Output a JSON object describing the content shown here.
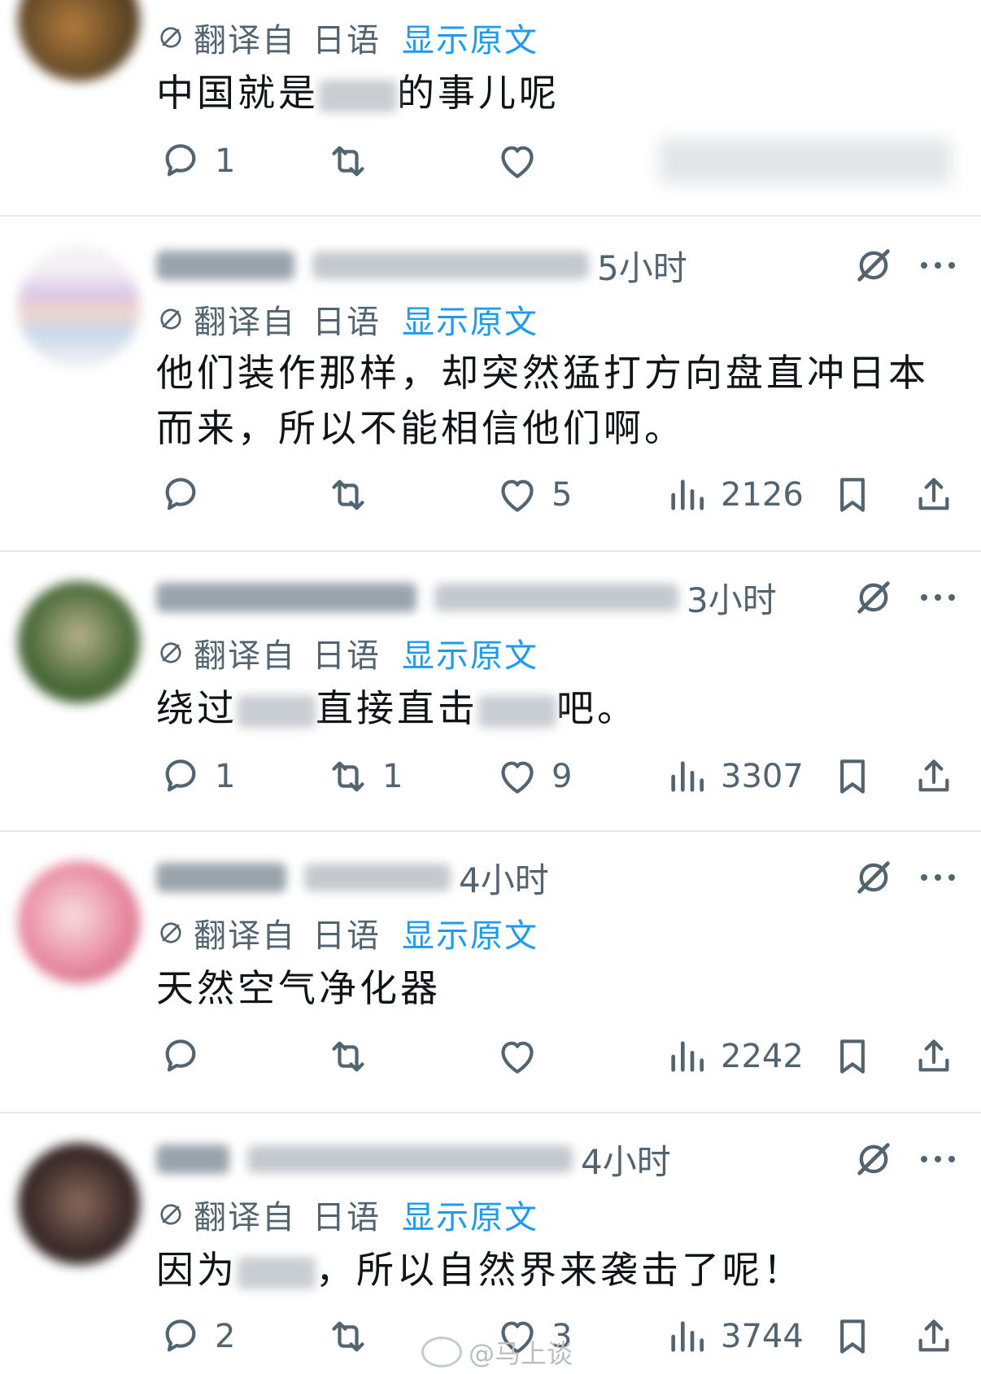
{
  "posts": [
    {
      "id": "p1",
      "name_visible": "",
      "time": "",
      "translation": {
        "label": "翻译自",
        "source": "日语",
        "show_original": "显示原文"
      },
      "text_before": "中国就是",
      "text_after": "的事儿呢",
      "actions": {
        "replies": "1",
        "reposts": "",
        "likes": "",
        "views": ""
      }
    },
    {
      "id": "p2",
      "time": "5小时",
      "translation": {
        "label": "翻译自",
        "source": "日语",
        "show_original": "显示原文"
      },
      "text": "他们装作那样，却突然猛打方向盘直冲日本而来，所以不能相信他们啊。",
      "actions": {
        "replies": "",
        "reposts": "",
        "likes": "5",
        "views": "2126"
      }
    },
    {
      "id": "p3",
      "time": "3小时",
      "translation": {
        "label": "翻译自",
        "source": "日语",
        "show_original": "显示原文"
      },
      "text_before": "绕过",
      "text_mid": "直接直击",
      "text_after": "吧。",
      "actions": {
        "replies": "1",
        "reposts": "1",
        "likes": "9",
        "views": "3307"
      }
    },
    {
      "id": "p4",
      "time": "4小时",
      "translation": {
        "label": "翻译自",
        "source": "日语",
        "show_original": "显示原文"
      },
      "text": "天然空气净化器",
      "actions": {
        "replies": "",
        "reposts": "",
        "likes": "",
        "views": "2242"
      }
    },
    {
      "id": "p5",
      "time": "4小时",
      "translation": {
        "label": "翻译自",
        "source": "日语",
        "show_original": "显示原文"
      },
      "text_before": "因为",
      "text_after": "，所以自然界来袭击了呢！",
      "actions": {
        "replies": "2",
        "reposts": "",
        "likes": "3",
        "views": "3744"
      }
    }
  ],
  "watermark": "@马上谈",
  "icons": [
    "grok-icon",
    "more-icon",
    "reply-icon",
    "repost-icon",
    "like-icon",
    "views-icon",
    "bookmark-icon",
    "share-icon",
    "translate-icon"
  ],
  "colors": {
    "accent": "#1d9bf0",
    "muted": "#536471",
    "text": "#0f1419",
    "separator": "#e6e9ec"
  }
}
